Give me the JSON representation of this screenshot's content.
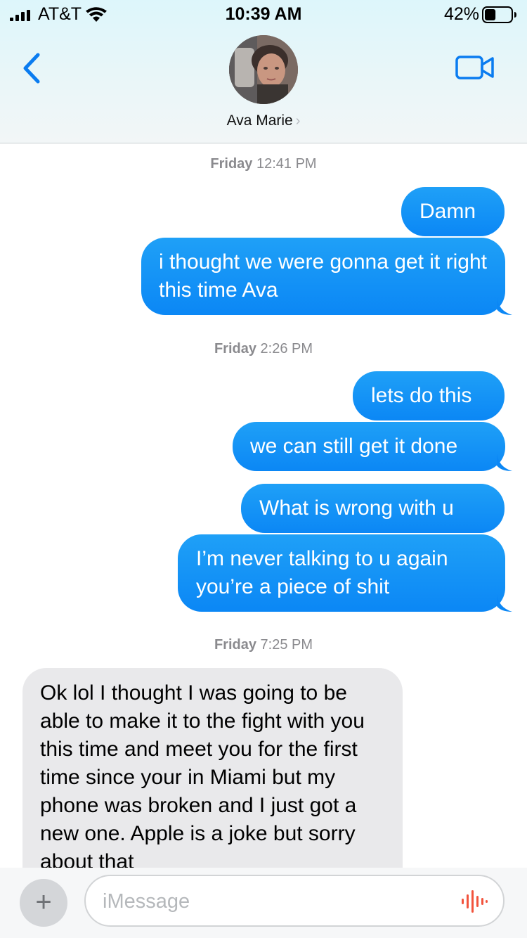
{
  "status_bar": {
    "carrier": "AT&T",
    "time": "10:39 AM",
    "battery_percent": "42%",
    "battery_level": 0.42,
    "icons": [
      "signal-icon",
      "wifi-icon",
      "battery-icon"
    ]
  },
  "header": {
    "back_icon": "chevron-left-icon",
    "contact_name": "Ava Marie",
    "contact_chevron": "›",
    "video_icon": "video-camera-icon"
  },
  "thread": {
    "groups": [
      {
        "timestamp_day": "Friday",
        "timestamp_time": "12:41 PM",
        "messages": [
          {
            "direction": "outgoing",
            "text": "Damn"
          },
          {
            "direction": "outgoing",
            "text": "i thought we were gonna get it right this time Ava"
          }
        ]
      },
      {
        "timestamp_day": "Friday",
        "timestamp_time": "2:26 PM",
        "messages": [
          {
            "direction": "outgoing",
            "text": "lets do this"
          },
          {
            "direction": "outgoing",
            "text": "we can still get it done"
          },
          {
            "direction": "outgoing",
            "text": "What is wrong with u"
          },
          {
            "direction": "outgoing",
            "text": "I’m never talking to u again you’re a piece of shit"
          }
        ]
      },
      {
        "timestamp_day": "Friday",
        "timestamp_time": "7:25 PM",
        "messages": [
          {
            "direction": "incoming",
            "text": "Ok lol I thought I was going to be able to make it to the fight with you this time and meet you for the first time since your in Miami but my phone was broken and I just got a new one. Apple is a joke but sorry about that"
          }
        ]
      }
    ]
  },
  "composer": {
    "plus_label": "+",
    "placeholder": "iMessage",
    "value": "",
    "audio_icon": "audio-waveform-icon"
  },
  "colors": {
    "outgoing_bubble": "#0b87f5",
    "incoming_bubble": "#e9e9eb",
    "accent": "#0a7cf0",
    "audio_accent": "#f2543d"
  }
}
